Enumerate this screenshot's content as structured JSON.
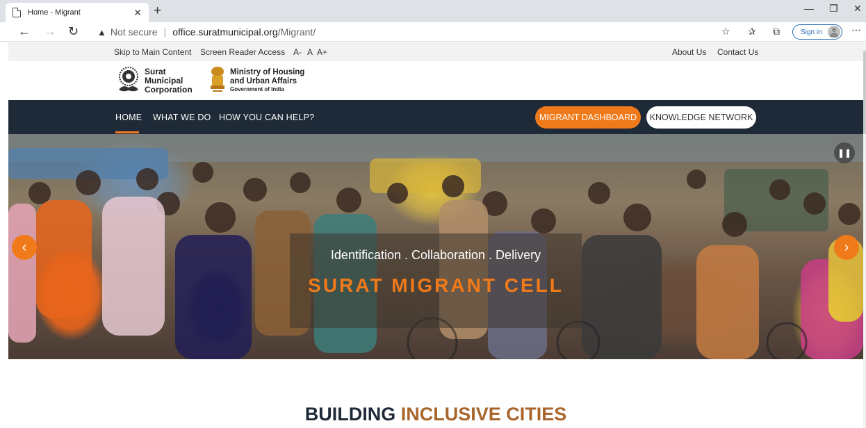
{
  "browser": {
    "tab_title": "Home - Migrant",
    "url_warning": "Not secure",
    "url_host": "office.suratmunicipal.org",
    "url_path": "/Migrant/",
    "signin_label": "Sign in"
  },
  "utility_bar": {
    "skip_label": "Skip to Main Content",
    "screen_reader_label": "Screen Reader Access",
    "font_small": "A-",
    "font_normal": "A",
    "font_large": "A+",
    "about_label": "About Us",
    "contact_label": "Contact Us"
  },
  "logos": {
    "smc_line1": "Surat",
    "smc_line2": "Municipal",
    "smc_line3": "Corporation",
    "mohua_line1": "Ministry of Housing",
    "mohua_line2": "and Urban Affairs",
    "mohua_line3": "Government of India"
  },
  "nav": {
    "home": "HOME",
    "what_we_do": "WHAT WE DO",
    "how_help": "HOW YOU CAN HELP?",
    "dashboard": "MIGRANT DASHBOARD",
    "knowledge": "KNOWLEDGE NETWORK"
  },
  "hero": {
    "tagline": "Identification . Collaboration . Delivery",
    "title": "SURAT MIGRANT CELL"
  },
  "section": {
    "heading_part1": "BUILDING ",
    "heading_part2": "INCLUSIVE CITIES"
  },
  "colors": {
    "accent": "#f07a1a",
    "nav_bg": "#1f2a38",
    "heading_dark": "#1f2a38",
    "heading_brown": "#a8652c"
  },
  "icons": [
    "page-icon",
    "close-icon",
    "plus-icon",
    "back-icon",
    "forward-icon",
    "reload-icon",
    "warning-icon",
    "favorites-add-icon",
    "favorites-icon",
    "collections-icon",
    "more-icon",
    "pause-icon",
    "chevron-left-icon",
    "chevron-right-icon"
  ]
}
